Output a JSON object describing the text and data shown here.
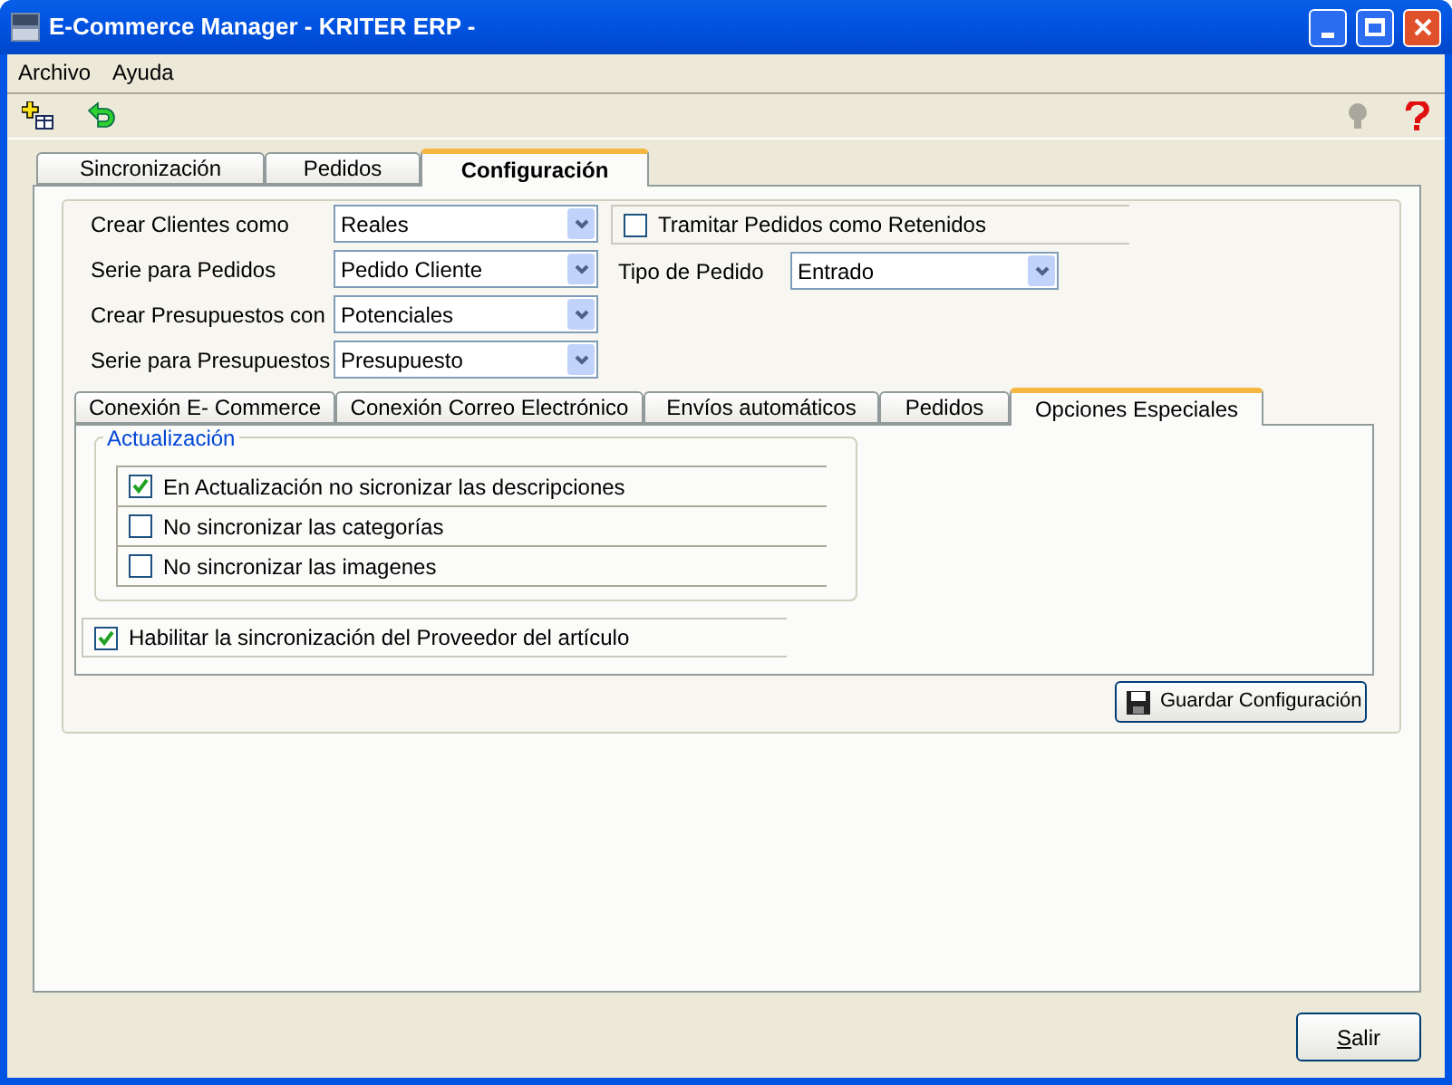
{
  "window": {
    "title": "E-Commerce Manager - KRITER ERP -"
  },
  "menu": [
    "Archivo",
    "Ayuda"
  ],
  "tabs": [
    {
      "label": "Sincronización",
      "selected": false
    },
    {
      "label": "Pedidos",
      "selected": false
    },
    {
      "label": "Configuración",
      "selected": true
    }
  ],
  "fields": [
    {
      "label": "Crear Clientes como",
      "value": "Reales"
    },
    {
      "label": "Serie para Pedidos",
      "value": "Pedido Cliente"
    },
    {
      "label": "Crear Presupuestos con",
      "value": "Potenciales"
    },
    {
      "label": "Serie para Presupuestos",
      "value": "Presupuesto"
    }
  ],
  "retain_orders": {
    "label": "Tramitar Pedidos como Retenidos",
    "checked": false
  },
  "order_type": {
    "label": "Tipo de Pedido",
    "value": "Entrado"
  },
  "subtabs": [
    {
      "label": "Conexión E- Commerce",
      "selected": false
    },
    {
      "label": "Conexión Correo Electrónico",
      "selected": false
    },
    {
      "label": "Envíos automáticos",
      "selected": false
    },
    {
      "label": "Pedidos",
      "selected": false
    },
    {
      "label": "Opciones Especiales",
      "selected": true
    }
  ],
  "update_group": {
    "title": "Actualización",
    "options": [
      {
        "label": "En Actualización no sicronizar las descripciones",
        "checked": true
      },
      {
        "label": "No sincronizar las categorías",
        "checked": false
      },
      {
        "label": "No sincronizar las imagenes",
        "checked": false
      }
    ]
  },
  "supplier_sync": {
    "label": "Habilitar la sincronización del Proveedor del artículo",
    "checked": true
  },
  "save_button": "Guardar Configuración",
  "exit_button": "Salir"
}
